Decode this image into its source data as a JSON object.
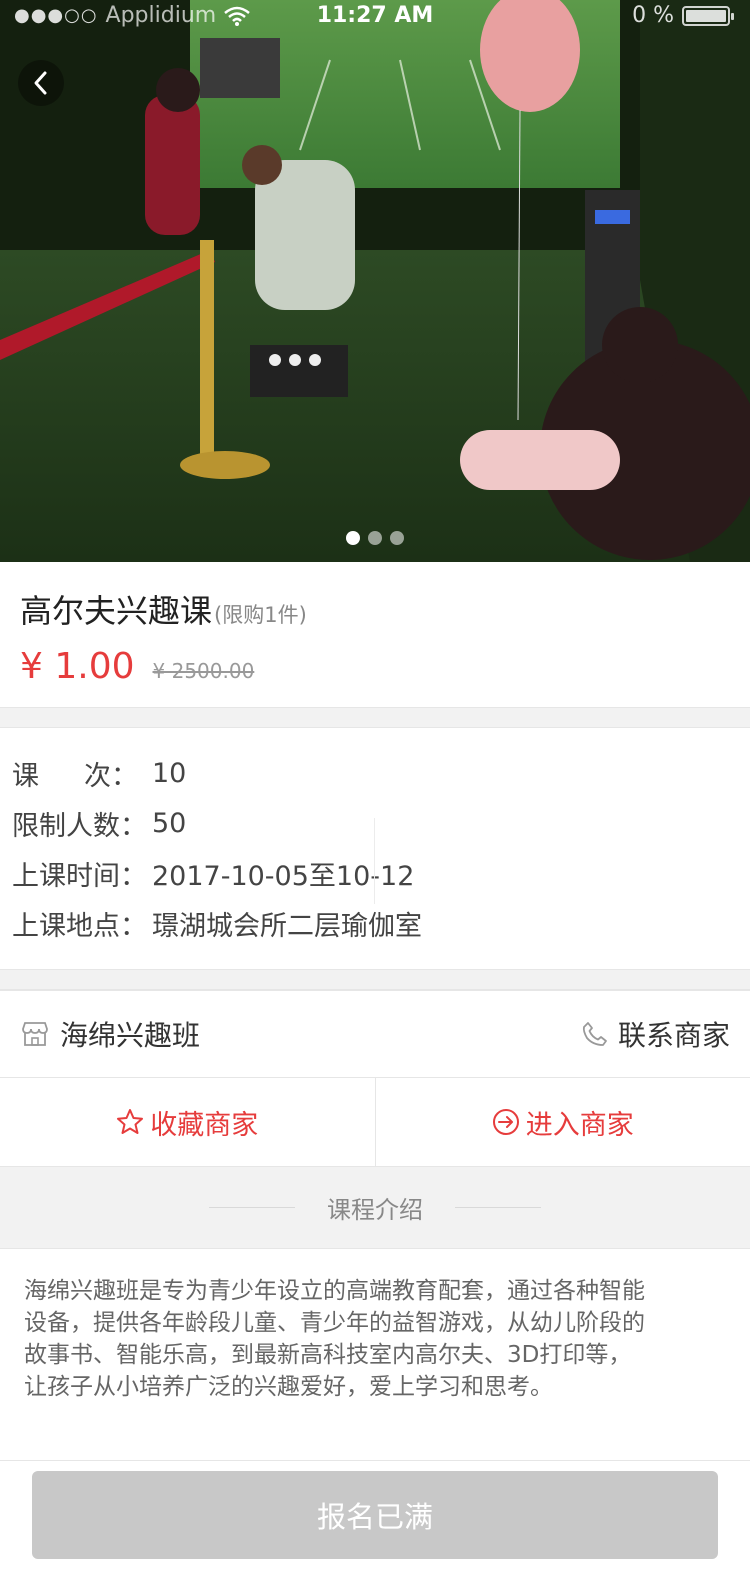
{
  "status_bar": {
    "signal": "●●●○○",
    "carrier": "Applidium",
    "time": "11:27 AM",
    "battery_text": "0 %"
  },
  "gallery": {
    "image_count": 3,
    "active_index": 0
  },
  "course": {
    "title": "高尔夫兴趣课",
    "limit": "(限购1件)",
    "price": "¥ 1.00",
    "original_price": "¥ 2500.00"
  },
  "info": {
    "sessions_label_a": "课",
    "sessions_label_b": "次：",
    "sessions_value": "10",
    "capacity_label": "限制人数：",
    "capacity_value": "50",
    "time_label": "上课时间：",
    "time_value": "2017-10-05至10-12",
    "location_label": "上课地点：",
    "location_value": "璟湖城会所二层瑜伽室"
  },
  "merchant": {
    "name": "海绵兴趣班",
    "contact_label": "联系商家",
    "favorite_label": "收藏商家",
    "enter_label": "进入商家"
  },
  "intro": {
    "heading": "课程介绍",
    "lines": [
      "海绵兴趣班是专为青少年设立的高端教育配套，通过各种智能",
      "设备，提供各年龄段儿童、青少年的益智游戏，从幼儿阶段的",
      "故事书、智能乐高，到最新高科技室内高尔夫、3D打印等，",
      "让孩子从小培养广泛的兴趣爱好，爱上学习和思考。"
    ]
  },
  "footer": {
    "signup_label": "报名已满"
  },
  "colors": {
    "accent": "#e63c3c",
    "disabled_button": "#c8c8c8"
  },
  "icons": {
    "back": "chevron-left-icon",
    "store": "store-icon",
    "phone": "phone-icon",
    "star": "star-icon",
    "enter": "arrow-circle-right-icon",
    "wifi": "wifi-icon",
    "battery": "battery-icon"
  }
}
